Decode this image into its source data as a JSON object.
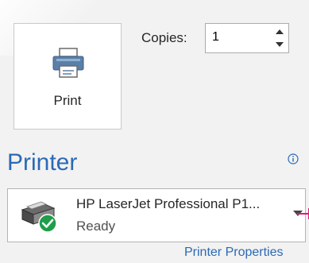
{
  "print": {
    "label": "Print"
  },
  "copies": {
    "label": "Copies:",
    "value": "1"
  },
  "printer": {
    "heading": "Printer",
    "selected_name": "HP LaserJet Professional P1...",
    "selected_status": "Ready",
    "properties_link": "Printer Properties"
  },
  "icons": {
    "print": "printer-icon",
    "info": "info-icon",
    "printer_device": "printer-ready-icon",
    "spin_up": "chevron-up-icon",
    "spin_down": "chevron-down-icon",
    "dropdown": "dropdown-arrow-icon"
  },
  "colors": {
    "accent": "#2a6ab5",
    "ready_badge": "#1e9e4a",
    "marker": "#e0197a"
  }
}
